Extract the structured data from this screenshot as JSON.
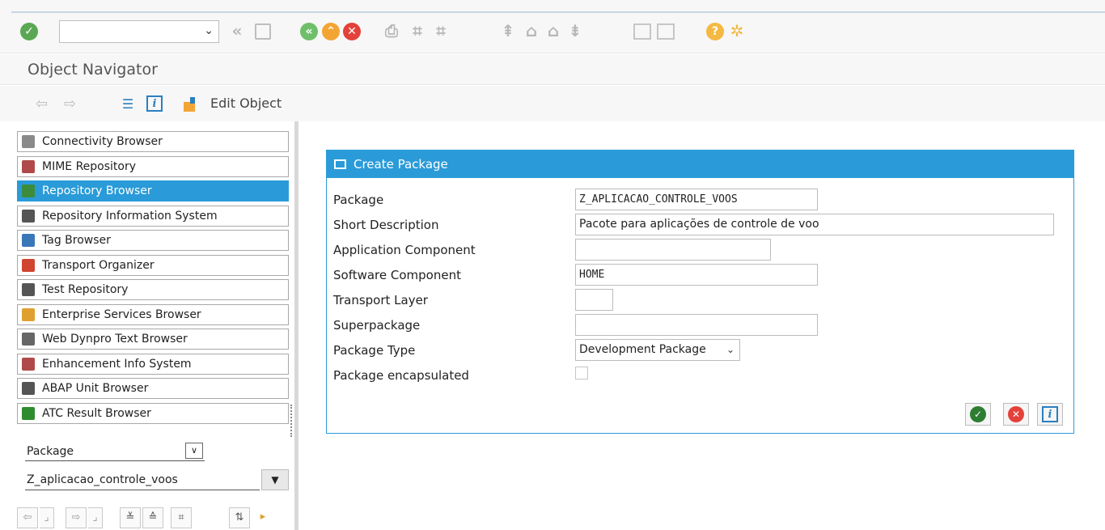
{
  "system_toolbar": {
    "command_value": "",
    "icons": [
      "enter-icon",
      "back-icon",
      "save-icon",
      "back-circle-icon",
      "exit-icon",
      "cancel-icon",
      "print-icon",
      "find-icon",
      "find-next-icon",
      "first-page-icon",
      "previous-page-icon",
      "next-page-icon",
      "last-page-icon",
      "create-session-icon",
      "shortcut-icon",
      "help-icon",
      "settings-icon"
    ]
  },
  "title_bar": {
    "title": "Object Navigator"
  },
  "app_toolbar": {
    "edit_object_label": "Edit Object"
  },
  "navigator": {
    "items": [
      {
        "label": "Connectivity Browser",
        "icon": "connectivity-icon",
        "color": "#8a8a8a"
      },
      {
        "label": "MIME Repository",
        "icon": "mime-icon",
        "color": "#b04a4a"
      },
      {
        "label": "Repository Browser",
        "icon": "repository-icon",
        "color": "#3c8c3c",
        "selected": true
      },
      {
        "label": "Repository Information System",
        "icon": "info-system-icon",
        "color": "#555555"
      },
      {
        "label": "Tag Browser",
        "icon": "tag-icon",
        "color": "#3a77b8"
      },
      {
        "label": "Transport Organizer",
        "icon": "transport-icon",
        "color": "#d0452f"
      },
      {
        "label": "Test Repository",
        "icon": "test-icon",
        "color": "#555555"
      },
      {
        "label": "Enterprise Services Browser",
        "icon": "enterprise-services-icon",
        "color": "#e0a030"
      },
      {
        "label": "Web Dynpro Text Browser",
        "icon": "web-dynpro-icon",
        "color": "#666666"
      },
      {
        "label": "Enhancement Info System",
        "icon": "enhancement-icon",
        "color": "#b04a4a"
      },
      {
        "label": "ABAP Unit Browser",
        "icon": "abap-unit-icon",
        "color": "#555555"
      },
      {
        "label": "ATC Result Browser",
        "icon": "atc-icon",
        "color": "#2e8b2e"
      }
    ],
    "object_type": "Package",
    "object_name": "Z_aplicacao_controle_voos"
  },
  "dialog": {
    "title": "Create Package",
    "fields": {
      "package": {
        "label": "Package",
        "value": "Z_APLICACAO_CONTROLE_VOOS"
      },
      "short_description": {
        "label": "Short Description",
        "value": "Pacote para aplicações de controle de voo"
      },
      "application_component": {
        "label": "Application Component",
        "value": ""
      },
      "software_component": {
        "label": "Software Component",
        "value": "HOME"
      },
      "transport_layer": {
        "label": "Transport Layer",
        "value": ""
      },
      "superpackage": {
        "label": "Superpackage",
        "value": ""
      },
      "package_type": {
        "label": "Package Type",
        "value": "Development Package"
      },
      "package_encapsulated": {
        "label": "Package encapsulated",
        "checked": false
      }
    },
    "accent_color": "#2a9bd8"
  }
}
